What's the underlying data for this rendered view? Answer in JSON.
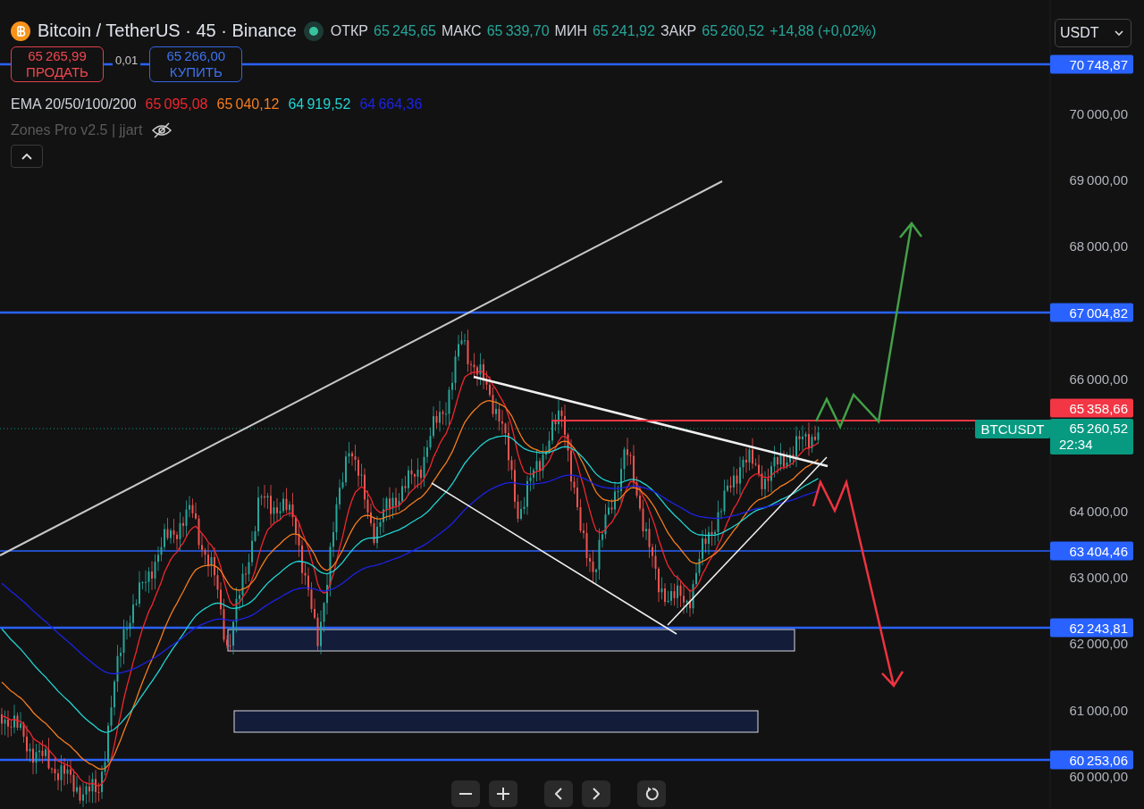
{
  "header": {
    "symbol": "Bitcoin / TetherUS · 45 · Binance",
    "ohlc": [
      {
        "label": "ОТКР",
        "value": "65 245,65"
      },
      {
        "label": "МАКС",
        "value": "65 339,70"
      },
      {
        "label": "МИН",
        "value": "65 241,92"
      },
      {
        "label": "ЗАКР",
        "value": "65 260,52"
      }
    ],
    "change": "+14,88 (+0,02%)"
  },
  "currency_select": {
    "value": "USDT"
  },
  "trade": {
    "sell": {
      "price": "65 265,99",
      "label": "ПРОДАТЬ"
    },
    "spread": "0,01",
    "buy": {
      "price": "65 266,00",
      "label": "КУПИТЬ"
    }
  },
  "indicators": [
    {
      "name": "EMA 20/50/100/200",
      "hidden": false,
      "values": [
        {
          "text": "65 095,08",
          "color": "#f0262f"
        },
        {
          "text": "65 040,12",
          "color": "#f57c1f"
        },
        {
          "text": "64 919,52",
          "color": "#22d3d3"
        },
        {
          "text": "64 664,36",
          "color": "#1c22e6"
        }
      ]
    },
    {
      "name": "Zones Pro v2.5 | jjart",
      "hidden": true
    }
  ],
  "price_axis": {
    "ticks": [
      "70 000,00",
      "69 000,00",
      "68 000,00",
      "66 000,00",
      "64 000,00",
      "63 000,00",
      "62 000,00",
      "61 000,00",
      "60 000,00"
    ]
  },
  "price_labels": [
    {
      "kind": "level",
      "price": "70 748,87"
    },
    {
      "kind": "level",
      "price": "67 004,82"
    },
    {
      "kind": "alert",
      "price": "65 358,66"
    },
    {
      "kind": "last",
      "price": "65 260,52",
      "countdown": "22:34",
      "symbol": "BTCUSDT"
    },
    {
      "kind": "level",
      "price": "63 404,46"
    },
    {
      "kind": "level",
      "price": "62 243,81"
    },
    {
      "kind": "level",
      "price": "60 253,06"
    }
  ]
}
